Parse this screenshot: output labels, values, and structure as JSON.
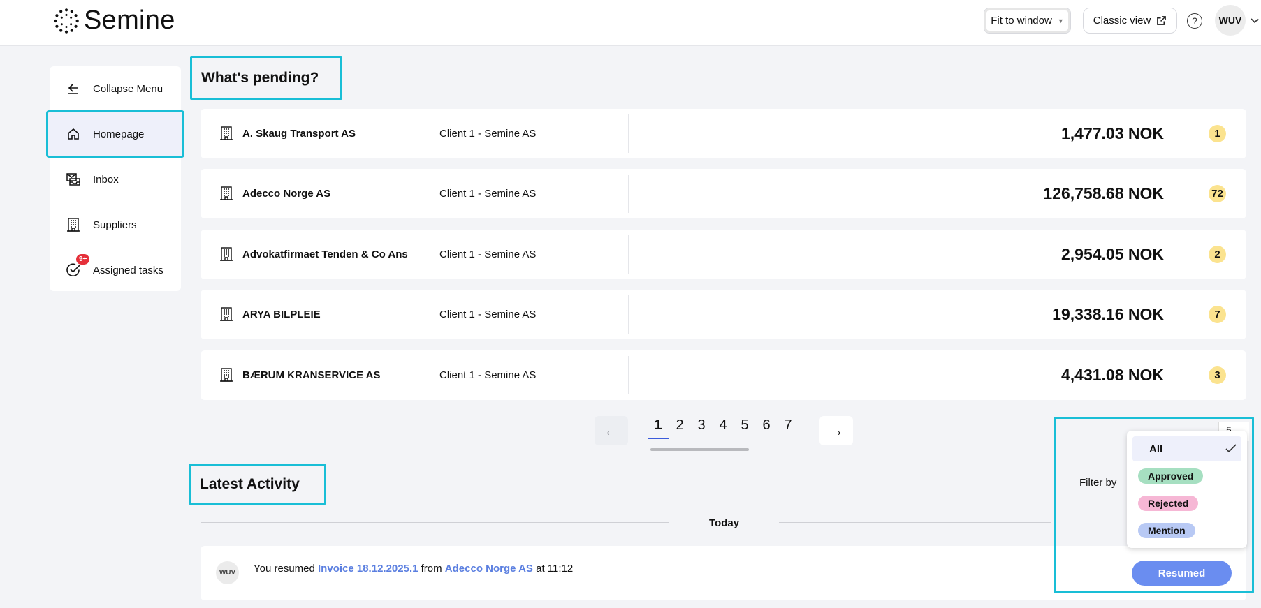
{
  "brand": {
    "name": "Semine"
  },
  "header": {
    "zoom_label": "Fit to window",
    "classic_label": "Classic view",
    "help_label": "?",
    "user_initials": "WUV"
  },
  "sidebar": {
    "items": [
      {
        "label": "Collapse Menu",
        "icon": "arrow-left-icon"
      },
      {
        "label": "Homepage",
        "icon": "home-icon",
        "active": true
      },
      {
        "label": "Inbox",
        "icon": "inbox-icon"
      },
      {
        "label": "Suppliers",
        "icon": "building-icon"
      },
      {
        "label": "Assigned tasks",
        "icon": "check-circle-icon",
        "badge": "9+"
      }
    ]
  },
  "pending": {
    "title": "What's pending?",
    "rows": [
      {
        "supplier": "A. Skaug Transport AS",
        "client": "Client 1 - Semine AS",
        "amount": "1,477.03 NOK",
        "count": "1"
      },
      {
        "supplier": "Adecco Norge AS",
        "client": "Client 1 - Semine AS",
        "amount": "126,758.68 NOK",
        "count": "72"
      },
      {
        "supplier": "Advokatfirmaet Tenden & Co Ans",
        "client": "Client 1 - Semine AS",
        "amount": "2,954.05 NOK",
        "count": "2"
      },
      {
        "supplier": "ARYA BILPLEIE",
        "client": "Client 1 - Semine AS",
        "amount": "19,338.16 NOK",
        "count": "7"
      },
      {
        "supplier": "BÆRUM KRANSERVICE AS",
        "client": "Client 1 - Semine AS",
        "amount": "4,431.08 NOK",
        "count": "3"
      }
    ],
    "pagination": {
      "pages": [
        "1",
        "2",
        "3",
        "4",
        "5",
        "6",
        "7"
      ],
      "current": "1",
      "prev": "←",
      "next": "→"
    },
    "per_page_partial": "5"
  },
  "activity": {
    "title": "Latest Activity",
    "filter_label": "Filter by",
    "day": "Today",
    "items": [
      {
        "avatar": "WUV",
        "prefix": "You resumed",
        "doc": "Invoice 18.12.2025.1",
        "mid": "from",
        "supplier": "Adecco Norge AS",
        "suffix": "at 11:12",
        "status": "Resumed"
      }
    ]
  },
  "filter": {
    "options": [
      {
        "label": "All",
        "selected": true
      },
      {
        "label": "Approved",
        "color": "#a6dfc1"
      },
      {
        "label": "Rejected",
        "color": "#f6b7d5"
      },
      {
        "label": "Mention",
        "color": "#b8c9f4"
      }
    ]
  },
  "colors": {
    "highlight": "#19bed6",
    "accent": "#6a8df0",
    "count_badge": "#fbe38f"
  }
}
